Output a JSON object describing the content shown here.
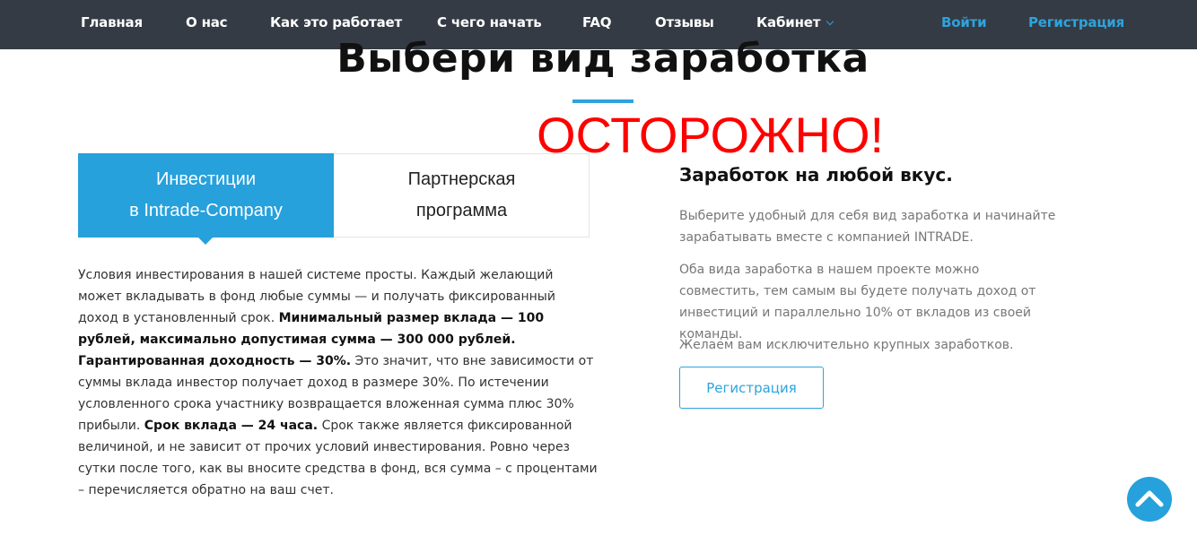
{
  "nav": {
    "items": [
      "Главная",
      "О нас",
      "Как это работает",
      "С чего начать",
      "FAQ",
      "Отзывы",
      "Кабинет"
    ],
    "login": "Войти",
    "register": "Регистрация"
  },
  "hero": {
    "title": "Выбери вид заработка",
    "warning": "ОСТОРОЖНО!"
  },
  "tabs": {
    "active": {
      "line1": "Инвестиции",
      "line2": "в Intrade-Company"
    },
    "inactive": {
      "line1": "Партнерская",
      "line2": "программа"
    }
  },
  "left": {
    "t1": "Условия инвестирования в нашей системе просты. Каждый желающий может вкладывать в фонд любые суммы — и получать фиксированный доход в установленный срок. ",
    "b1": "Минимальный размер вклада — 100 рублей, максимально допустимая сумма — 300 000 рублей. Гарантированная доходность — 30%.",
    "t2": " Это значит, что вне зависимости от суммы вклада инвестор получает доход в размере 30%. По истечении условленного срока участнику возвращается вложенная сумма плюс 30% прибыли. ",
    "b2": "Срок вклада — 24 часа.",
    "t3": " Срок также является фиксированной величиной, и не зависит от прочих условий инвестирования. Ровно через сутки после того, как вы вносите средства в фонд, вся сумма – с процентами – перечисляется обратно на ваш счет."
  },
  "right": {
    "heading": "Заработок на любой вкус.",
    "p1": "Выберите удобный для себя вид заработка и начинайте зарабатывать вместе с компанией INTRADE.",
    "p2": "Оба вида заработка в нашем проекте можно совместить, тем самым вы будете получать доход от инвестиций и параллельно 10% от вкладов из своей команды.",
    "p3": "Желаем вам исключительно крупных заработков.",
    "button": "Регистрация"
  },
  "icons": {
    "cabinet": "chevron-down-icon",
    "scroll_top": "chevron-up-icon"
  },
  "colors": {
    "nav_bg": "#353b44",
    "accent": "#26a1dc",
    "warning": "#ff0000"
  }
}
